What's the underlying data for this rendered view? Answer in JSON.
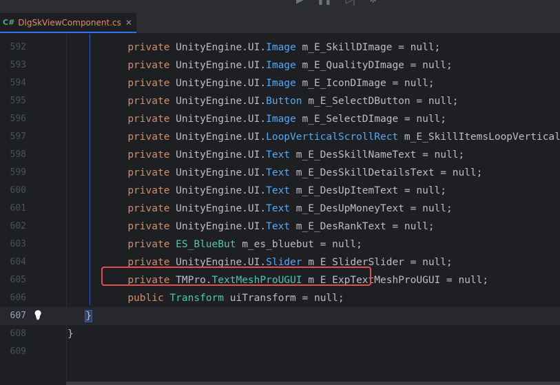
{
  "tab": {
    "lang": "C#",
    "title": "DlgSkViewComponent.cs",
    "close": "✕"
  },
  "toolbar": {
    "run_icon": "run-icon",
    "pause_icon": "pause-icon",
    "step_icon": "step-icon",
    "debug_icon": "debug-icon"
  },
  "editor": {
    "current_line": "607",
    "lines": [
      {
        "n": "592",
        "mod": "private",
        "ns": "UnityEngine.UI.",
        "type": "Image",
        "rest": " m_E_SkillDImage = null;"
      },
      {
        "n": "593",
        "mod": "private",
        "ns": "UnityEngine.UI.",
        "type": "Image",
        "rest": " m_E_QualityDImage = null;"
      },
      {
        "n": "594",
        "mod": "private",
        "ns": "UnityEngine.UI.",
        "type": "Image",
        "rest": " m_E_IconDImage = null;"
      },
      {
        "n": "595",
        "mod": "private",
        "ns": "UnityEngine.UI.",
        "type": "Button",
        "rest": " m_E_SelectDButton = null;"
      },
      {
        "n": "596",
        "mod": "private",
        "ns": "UnityEngine.UI.",
        "type": "Image",
        "rest": " m_E_SelectDImage = null;"
      },
      {
        "n": "597",
        "mod": "private",
        "ns": "UnityEngine.UI.",
        "type": "LoopVerticalScrollRect",
        "rest": " m_E_SkillItemsLoopVertical"
      },
      {
        "n": "598",
        "mod": "private",
        "ns": "UnityEngine.UI.",
        "type": "Text",
        "rest": " m_E_DesSkillNameText = null;"
      },
      {
        "n": "599",
        "mod": "private",
        "ns": "UnityEngine.UI.",
        "type": "Text",
        "rest": " m_E_DesSkillDetailsText = null;"
      },
      {
        "n": "600",
        "mod": "private",
        "ns": "UnityEngine.UI.",
        "type": "Text",
        "rest": " m_E_DesUpItemText = null;"
      },
      {
        "n": "601",
        "mod": "private",
        "ns": "UnityEngine.UI.",
        "type": "Text",
        "rest": " m_E_DesUpMoneyText = null;"
      },
      {
        "n": "602",
        "mod": "private",
        "ns": "UnityEngine.UI.",
        "type": "Text",
        "rest": " m_E_DesRankText = null;"
      },
      {
        "n": "603",
        "mod": "private",
        "ns": "",
        "type": "ES_BlueBut",
        "rest": " m_es_bluebut = null;"
      },
      {
        "n": "604",
        "mod": "private",
        "ns": "UnityEngine.UI.",
        "type": "Slider",
        "rest": " m_E_SliderSlider = null;"
      },
      {
        "n": "605",
        "mod": "private",
        "ns": "TMPro.",
        "type": "TextMeshProUGUI",
        "rest": " m_E_ExpTextMeshProUGUI = null;"
      },
      {
        "n": "606",
        "mod": "public",
        "ns": "",
        "type": "Transform",
        "rest": " uiTransform = null;"
      },
      {
        "n": "607",
        "code": "}"
      },
      {
        "n": "608",
        "code": "}"
      },
      {
        "n": "609",
        "code": ""
      }
    ]
  },
  "colors": {
    "keyword": "#cf8e6d",
    "ui_type": "#56a8f5",
    "class_type": "#4dc9a8",
    "highlight_box": "#e34e4e",
    "current_line": "#26282e"
  }
}
